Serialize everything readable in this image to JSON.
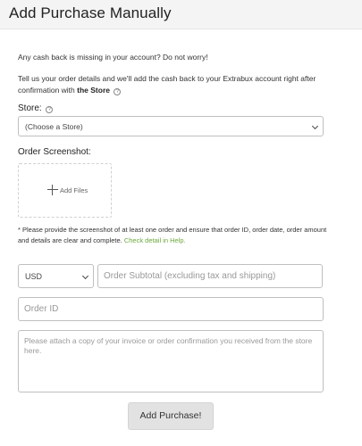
{
  "header": {
    "title": "Add Purchase Manually"
  },
  "intro": {
    "line1": "Any cash back is missing in your account? Do not worry!",
    "line2_prefix": "Tell us your order details and we'll add the cash back to your Extrabux account right after confirmation with",
    "line2_bold": "the Store",
    "help_glyph": "?"
  },
  "store": {
    "label": "Store:",
    "help_glyph": "?",
    "selected": "(Choose a Store)"
  },
  "screenshot": {
    "label": "Order Screenshot:",
    "add_files": "Add Files"
  },
  "note": {
    "text": "* Please provide the screenshot of at least one order and ensure that order ID, order date, order amount and details are clear and complete.",
    "link": "Check detail in Help."
  },
  "form": {
    "currency": "USD",
    "subtotal_placeholder": "Order Subtotal (excluding tax and shipping)",
    "order_id_placeholder": "Order ID",
    "notes_placeholder": "Please attach a copy of your invoice or order confirmation you received from the store here."
  },
  "submit": {
    "label": "Add Purchase!"
  },
  "colors": {
    "link": "#6aa83a",
    "header_bg": "#f4f4f4",
    "button_bg": "#e2e2e2"
  }
}
